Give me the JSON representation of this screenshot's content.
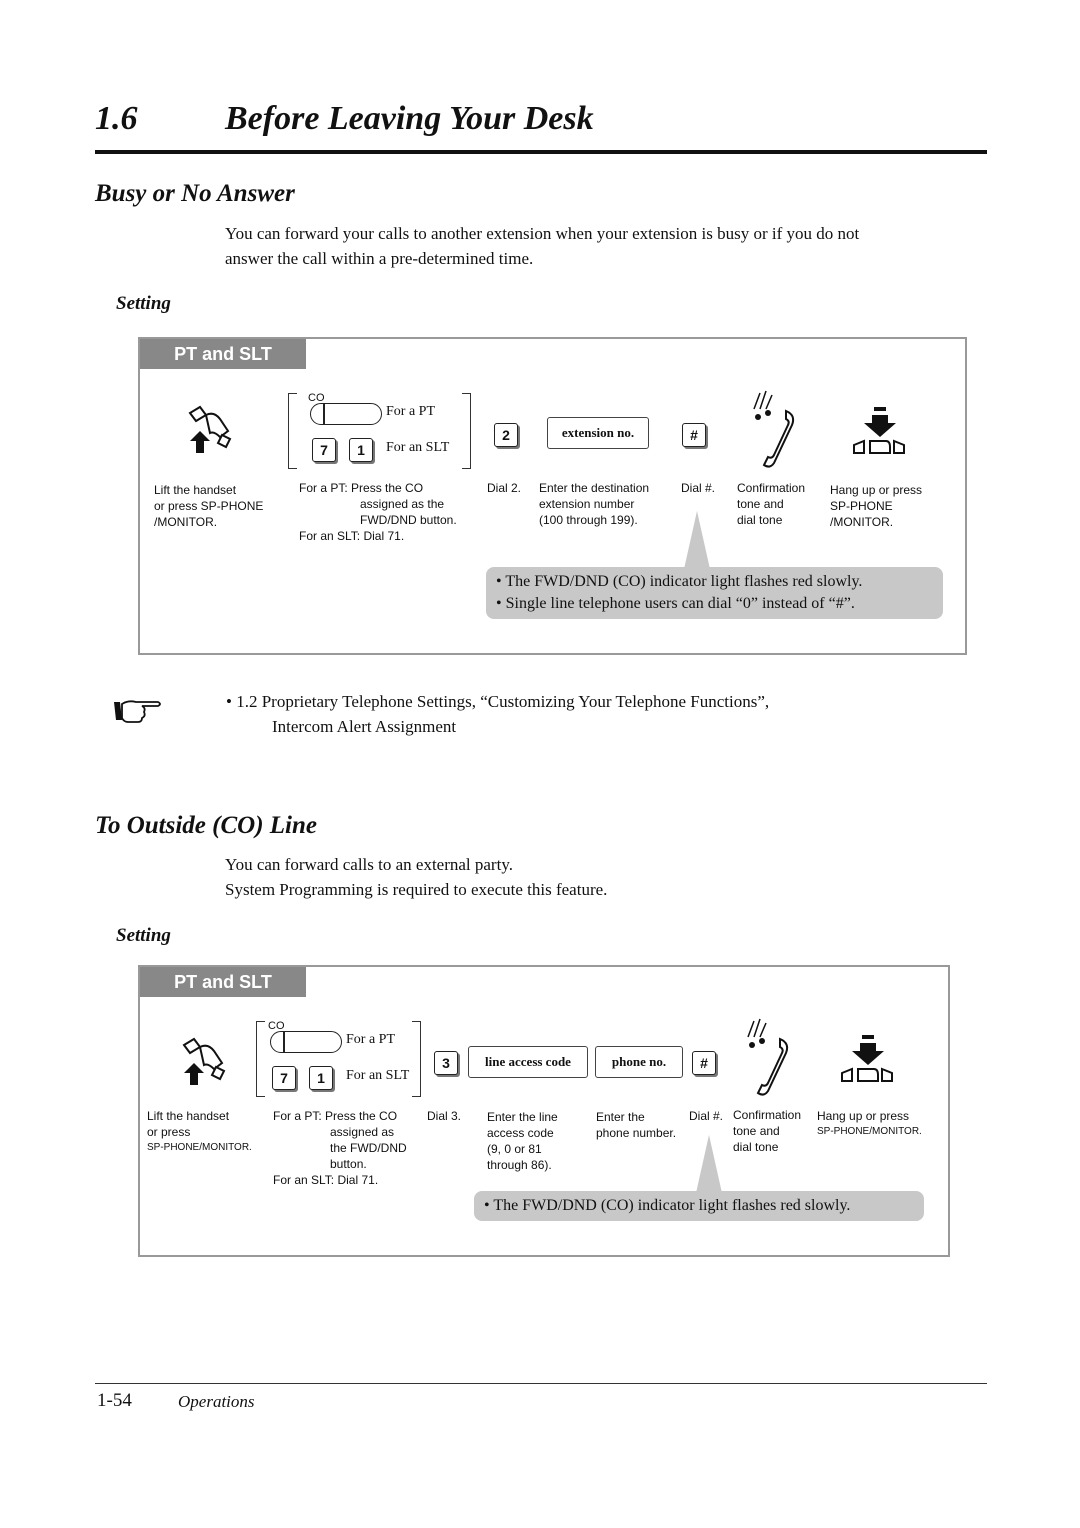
{
  "header": {
    "section_number": "1.6",
    "section_title": "Before Leaving Your Desk"
  },
  "busy": {
    "title": "Busy or No Answer",
    "intro_1": "You can forward your calls to another extension when your extension is busy or if you do not",
    "intro_2": "answer the call within a pre-determined time.",
    "setting_label": "Setting",
    "tab_label": "PT and SLT",
    "co_label": "CO",
    "for_pt": "For a PT",
    "for_slt": "For an SLT",
    "key_7": "7",
    "key_1": "1",
    "key_2": "2",
    "key_hash": "#",
    "field_ext": "extension no.",
    "step1": [
      "Lift the handset",
      "or press SP-PHONE",
      "/MONITOR."
    ],
    "step2": [
      "For a PT: Press the CO",
      "assigned as the",
      "FWD/DND button.",
      "For an SLT: Dial 71."
    ],
    "step3": "Dial 2.",
    "step4": [
      "Enter the destination",
      "extension number",
      "(100 through 199)."
    ],
    "step5": "Dial #.",
    "step6": [
      "Confirmation",
      "tone and",
      "dial tone"
    ],
    "step7": [
      "Hang up or press",
      "SP-PHONE",
      "/MONITOR."
    ],
    "notes": [
      "The FWD/DND (CO) indicator light flashes red slowly.",
      "Single line telephone users can dial “0” instead of “#”."
    ]
  },
  "reference": {
    "line1": "1.2 Proprietary Telephone Settings, “Customizing Your Telephone Functions”,",
    "line2": "Intercom Alert Assignment"
  },
  "outside": {
    "title": "To Outside (CO) Line",
    "intro_1": "You can forward calls to an external party.",
    "intro_2": "System Programming is required to execute this feature.",
    "setting_label": "Setting",
    "tab_label": "PT and SLT",
    "co_label": "CO",
    "for_pt": "For a PT",
    "for_slt": "For an SLT",
    "key_7": "7",
    "key_1": "1",
    "key_3": "3",
    "key_hash": "#",
    "field_lac": "line access code",
    "field_phone": "phone no.",
    "step1": [
      "Lift the handset",
      "or press",
      "SP-PHONE/MONITOR."
    ],
    "step2": [
      "For a PT: Press the CO",
      "assigned as",
      "the FWD/DND",
      "button.",
      "For an SLT: Dial 71."
    ],
    "step3": "Dial 3.",
    "step4": [
      "Enter the line",
      "access code",
      "(9, 0 or 81",
      "through 86)."
    ],
    "step5": [
      "Enter the",
      "phone number."
    ],
    "step6": "Dial #.",
    "step7": [
      "Confirmation",
      "tone and",
      "dial tone"
    ],
    "step8": [
      "Hang up or press",
      "SP-PHONE/MONITOR."
    ],
    "notes": [
      "The FWD/DND (CO) indicator light flashes red slowly."
    ]
  },
  "footer": {
    "page": "1-54",
    "section": "Operations"
  }
}
